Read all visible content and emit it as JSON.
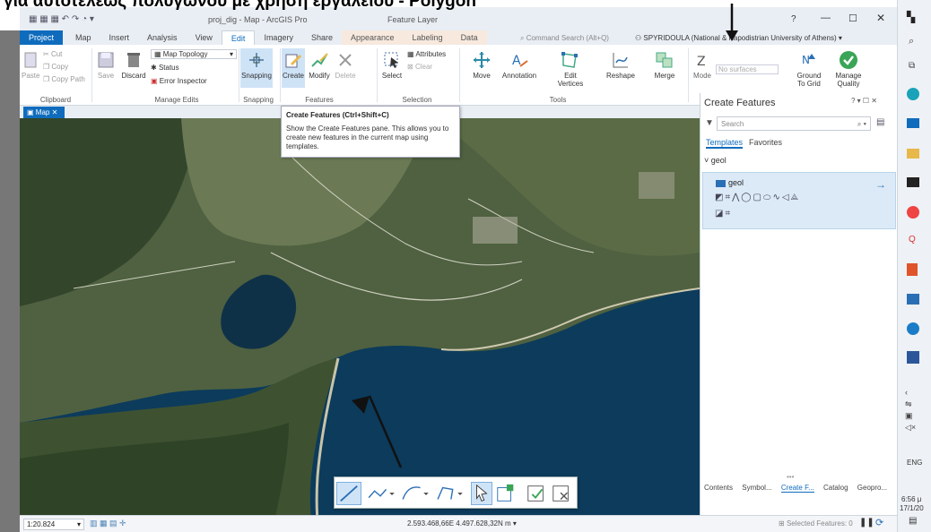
{
  "overlay_title": "για αυτοτελέως πολύγωνου με χρήση εργαλείου - Polygon",
  "window": {
    "title": "proj_dig - Map - ArcGIS Pro",
    "context": "Feature Layer",
    "search_placeholder": "Command Search (Alt+Q)",
    "user": "SPYRIDOULA (National & Kapodistrian University of Athens)",
    "help": "?"
  },
  "ribbon_tabs": [
    "Project",
    "Map",
    "Insert",
    "Analysis",
    "View",
    "Edit",
    "Imagery",
    "Share",
    "Appearance",
    "Labeling",
    "Data"
  ],
  "ribbon": {
    "clipboard": {
      "label": "Clipboard",
      "paste": "Paste",
      "cut": "Cut",
      "copy": "Copy",
      "copy_path": "Copy Path"
    },
    "manage_edits": {
      "label": "Manage Edits",
      "save": "Save",
      "discard": "Discard",
      "map_topology": "Map Topology",
      "status": "Status",
      "error_inspector": "Error Inspector"
    },
    "snapping": {
      "label": "Snapping",
      "snapping": "Snapping"
    },
    "features": {
      "label": "Features",
      "create": "Create",
      "modify": "Modify",
      "delete": "Delete"
    },
    "selection": {
      "label": "Selection",
      "select": "Select",
      "attributes": "Attributes",
      "clear": "Clear"
    },
    "tools": {
      "label": "Tools",
      "move": "Move",
      "annotation": "Annotation",
      "edit_vertices": "Edit Vertices",
      "reshape": "Reshape",
      "merge": "Merge"
    },
    "elevation": {
      "mode": "Mode",
      "no_surfaces": "No surfaces",
      "ground_to_grid": "Ground To Grid",
      "manage_quality": "Manage Quality"
    }
  },
  "map_tab": "Map",
  "tooltip": {
    "title": "Create Features (Ctrl+Shift+C)",
    "description": "Show the Create Features pane. This allows you to create new features in the current map using templates."
  },
  "create_features": {
    "title": "Create Features",
    "search_placeholder": "Search",
    "tabs": [
      "Templates",
      "Favorites"
    ],
    "group": "geol",
    "template": "geol",
    "bottom_tabs": [
      "Contents",
      "Symbol...",
      "Create F...",
      "Catalog",
      "Geopro..."
    ]
  },
  "status": {
    "scale": "1:20.824",
    "coordinates": "2.593.468,66E 4.497.628,32N m",
    "selected_features": "Selected Features: 0"
  },
  "taskbar": {
    "lang": "ENG",
    "time": "6:56 μ",
    "date": "17/1/20"
  },
  "colors": {
    "accent": "#0f6cbd",
    "ribbon_bg": "#e9eef4",
    "context_tab": "#f7e9de",
    "sea": "#0c3b5c",
    "land": "#4a5c3a"
  }
}
